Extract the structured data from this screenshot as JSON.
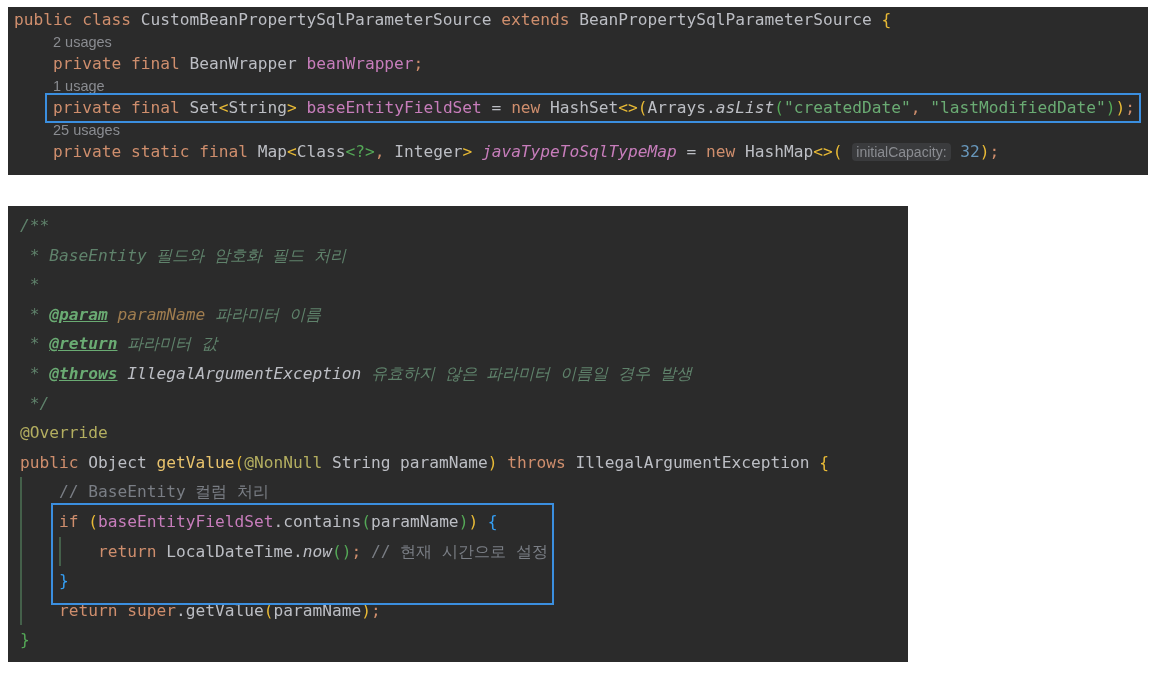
{
  "panels": [
    {
      "nodes": [
        {
          "kind": "line",
          "tokens": [
            {
              "kind": "kw",
              "text": "public class "
            },
            {
              "kind": "plain",
              "text": "CustomBeanPropertySqlParameterSource "
            },
            {
              "kind": "kw",
              "text": "extends "
            },
            {
              "kind": "plain",
              "text": "BeanPropertySqlParameterSource "
            },
            {
              "kind": "brace",
              "text": "{"
            }
          ],
          "children": [
            {
              "kind": "hint",
              "text": "2 usages"
            },
            {
              "kind": "line",
              "tokens": [
                {
                  "kind": "kw",
                  "text": "private final "
                },
                {
                  "kind": "plain",
                  "text": "BeanWrapper "
                },
                {
                  "kind": "field",
                  "text": "beanWrapper"
                },
                {
                  "kind": "kw",
                  "text": ";"
                }
              ]
            },
            {
              "kind": "hint",
              "text": "1 usage"
            },
            {
              "kind": "group",
              "boxed": true,
              "lines": [
                {
                  "kind": "line",
                  "tokens": [
                    {
                      "kind": "kw",
                      "text": "private final "
                    },
                    {
                      "kind": "plain",
                      "text": "Set"
                    },
                    {
                      "kind": "brace",
                      "text": "<"
                    },
                    {
                      "kind": "plain",
                      "text": "String"
                    },
                    {
                      "kind": "brace",
                      "text": "> "
                    },
                    {
                      "kind": "field",
                      "text": "baseEntityFieldSet"
                    },
                    {
                      "kind": "plain",
                      "text": " = "
                    },
                    {
                      "kind": "kw",
                      "text": "new "
                    },
                    {
                      "kind": "plain",
                      "text": "HashSet"
                    },
                    {
                      "kind": "brace",
                      "text": "<>("
                    },
                    {
                      "kind": "plain",
                      "text": "Arrays."
                    },
                    {
                      "kind": "call",
                      "text": "asList"
                    },
                    {
                      "kind": "paren2",
                      "text": "("
                    },
                    {
                      "kind": "string",
                      "text": "\"createdDate\""
                    },
                    {
                      "kind": "kw",
                      "text": ", "
                    },
                    {
                      "kind": "string",
                      "text": "\"lastModifiedDate\""
                    },
                    {
                      "kind": "paren2",
                      "text": ")"
                    },
                    {
                      "kind": "brace",
                      "text": ")"
                    },
                    {
                      "kind": "kw",
                      "text": ";"
                    }
                  ]
                }
              ]
            },
            {
              "kind": "hint",
              "text": "25 usages"
            },
            {
              "kind": "line",
              "tokens": [
                {
                  "kind": "kw",
                  "text": "private static final "
                },
                {
                  "kind": "plain",
                  "text": "Map"
                },
                {
                  "kind": "brace",
                  "text": "<"
                },
                {
                  "kind": "plain",
                  "text": "Class"
                },
                {
                  "kind": "paren2",
                  "text": "<?>"
                },
                {
                  "kind": "kw",
                  "text": ", "
                },
                {
                  "kind": "plain",
                  "text": "Integer"
                },
                {
                  "kind": "brace",
                  "text": "> "
                },
                {
                  "kind": "sfield",
                  "text": "javaTypeToSqlTypeMap"
                },
                {
                  "kind": "plain",
                  "text": " = "
                },
                {
                  "kind": "kw",
                  "text": "new "
                },
                {
                  "kind": "plain",
                  "text": "HashMap"
                },
                {
                  "kind": "brace",
                  "text": "<>( "
                },
                {
                  "kind": "inlay",
                  "text": "initialCapacity:"
                },
                {
                  "kind": "number",
                  "text": " 32"
                },
                {
                  "kind": "brace",
                  "text": ")"
                },
                {
                  "kind": "kw",
                  "text": ";"
                }
              ]
            }
          ]
        }
      ]
    },
    {
      "nodes": [
        {
          "kind": "line",
          "tokens": [
            {
              "kind": "doc",
              "text": "/**"
            }
          ]
        },
        {
          "kind": "line",
          "tokens": [
            {
              "kind": "doc",
              "text": " * BaseEntity 필드와 암호화 필드 처리"
            }
          ]
        },
        {
          "kind": "line",
          "tokens": [
            {
              "kind": "doc",
              "text": " *"
            }
          ]
        },
        {
          "kind": "line",
          "tokens": [
            {
              "kind": "doc",
              "text": " * "
            },
            {
              "kind": "tag",
              "text": "@param"
            },
            {
              "kind": "dparam",
              "text": " paramName"
            },
            {
              "kind": "doc",
              "text": " 파라미터 이름"
            }
          ]
        },
        {
          "kind": "line",
          "tokens": [
            {
              "kind": "doc",
              "text": " * "
            },
            {
              "kind": "tag",
              "text": "@return"
            },
            {
              "kind": "doc",
              "text": " 파라미터 값"
            }
          ]
        },
        {
          "kind": "line",
          "tokens": [
            {
              "kind": "doc",
              "text": " * "
            },
            {
              "kind": "tag",
              "text": "@throws"
            },
            {
              "kind": "docref",
              "text": " IllegalArgumentException"
            },
            {
              "kind": "doc",
              "text": " 유효하지 않은 파라미터 이름일 경우 발생"
            }
          ]
        },
        {
          "kind": "line",
          "tokens": [
            {
              "kind": "doc",
              "text": " */"
            }
          ]
        },
        {
          "kind": "line",
          "tokens": [
            {
              "kind": "annot",
              "text": "@Override"
            }
          ]
        },
        {
          "kind": "line",
          "guide": true,
          "tokens": [
            {
              "kind": "kw",
              "text": "public "
            },
            {
              "kind": "plain",
              "text": "Object "
            },
            {
              "kind": "method",
              "text": "getValue"
            },
            {
              "kind": "brace",
              "text": "("
            },
            {
              "kind": "annot",
              "text": "@NonNull"
            },
            {
              "kind": "plain",
              "text": " String paramName"
            },
            {
              "kind": "brace",
              "text": ")"
            },
            {
              "kind": "kw",
              "text": " throws "
            },
            {
              "kind": "plain",
              "text": "IllegalArgumentException "
            },
            {
              "kind": "brace",
              "text": "{"
            }
          ],
          "children": [
            {
              "kind": "line",
              "tokens": [
                {
                  "kind": "comment",
                  "text": "// BaseEntity 컬럼 처리"
                }
              ]
            },
            {
              "kind": "group",
              "boxed": true,
              "lines": [
                {
                  "kind": "line",
                  "guide": true,
                  "tokens": [
                    {
                      "kind": "kw",
                      "text": "if "
                    },
                    {
                      "kind": "brace",
                      "text": "("
                    },
                    {
                      "kind": "field",
                      "text": "baseEntityFieldSet"
                    },
                    {
                      "kind": "plain",
                      "text": ".contains"
                    },
                    {
                      "kind": "paren2",
                      "text": "("
                    },
                    {
                      "kind": "plain",
                      "text": "paramName"
                    },
                    {
                      "kind": "paren2",
                      "text": ")"
                    },
                    {
                      "kind": "brace",
                      "text": ")"
                    },
                    {
                      "kind": "bluebrace",
                      "text": " {"
                    }
                  ],
                  "children": [
                    {
                      "kind": "line",
                      "tokens": [
                        {
                          "kind": "kw",
                          "text": "return "
                        },
                        {
                          "kind": "plain",
                          "text": "LocalDateTime."
                        },
                        {
                          "kind": "call",
                          "text": "now"
                        },
                        {
                          "kind": "paren2",
                          "text": "()"
                        },
                        {
                          "kind": "kw",
                          "text": ";"
                        },
                        {
                          "kind": "comment",
                          "text": " // 현재 시간으로 설정"
                        }
                      ]
                    }
                  ]
                },
                {
                  "kind": "line",
                  "tokens": [
                    {
                      "kind": "bluebrace",
                      "text": "}"
                    }
                  ]
                }
              ]
            },
            {
              "kind": "line",
              "tokens": [
                {
                  "kind": "kw",
                  "text": "return super"
                },
                {
                  "kind": "plain",
                  "text": ".getValue"
                },
                {
                  "kind": "brace",
                  "text": "("
                },
                {
                  "kind": "plain",
                  "text": "paramName"
                },
                {
                  "kind": "brace",
                  "text": ")"
                },
                {
                  "kind": "kw",
                  "text": ";"
                }
              ]
            }
          ]
        },
        {
          "kind": "line",
          "tokens": [
            {
              "kind": "greenbrace",
              "text": "}"
            }
          ]
        }
      ]
    }
  ]
}
